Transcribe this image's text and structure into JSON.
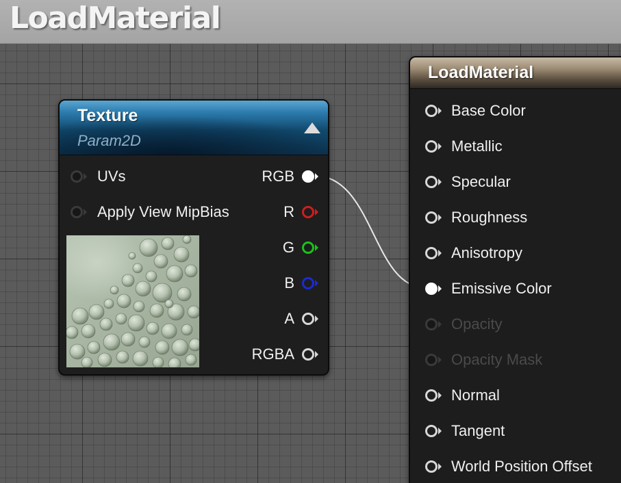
{
  "window": {
    "title": "LoadMaterial"
  },
  "texture_node": {
    "title": "Texture",
    "subtitle": "Param2D",
    "inputs": [
      "UVs",
      "Apply View MipBias"
    ],
    "outputs": [
      "RGB",
      "R",
      "G",
      "B",
      "A",
      "RGBA"
    ]
  },
  "material_node": {
    "title": "LoadMaterial",
    "inputs": [
      "Base Color",
      "Metallic",
      "Specular",
      "Roughness",
      "Anisotropy",
      "Emissive Color",
      "Opacity",
      "Opacity Mask",
      "Normal",
      "Tangent",
      "World Position Offset"
    ]
  },
  "colors": {
    "r_pin": "#d11d1d",
    "g_pin": "#19c319",
    "b_pin": "#1a2ad6",
    "texture_header": "#1f6a9c",
    "material_header": "#9f8e76"
  }
}
